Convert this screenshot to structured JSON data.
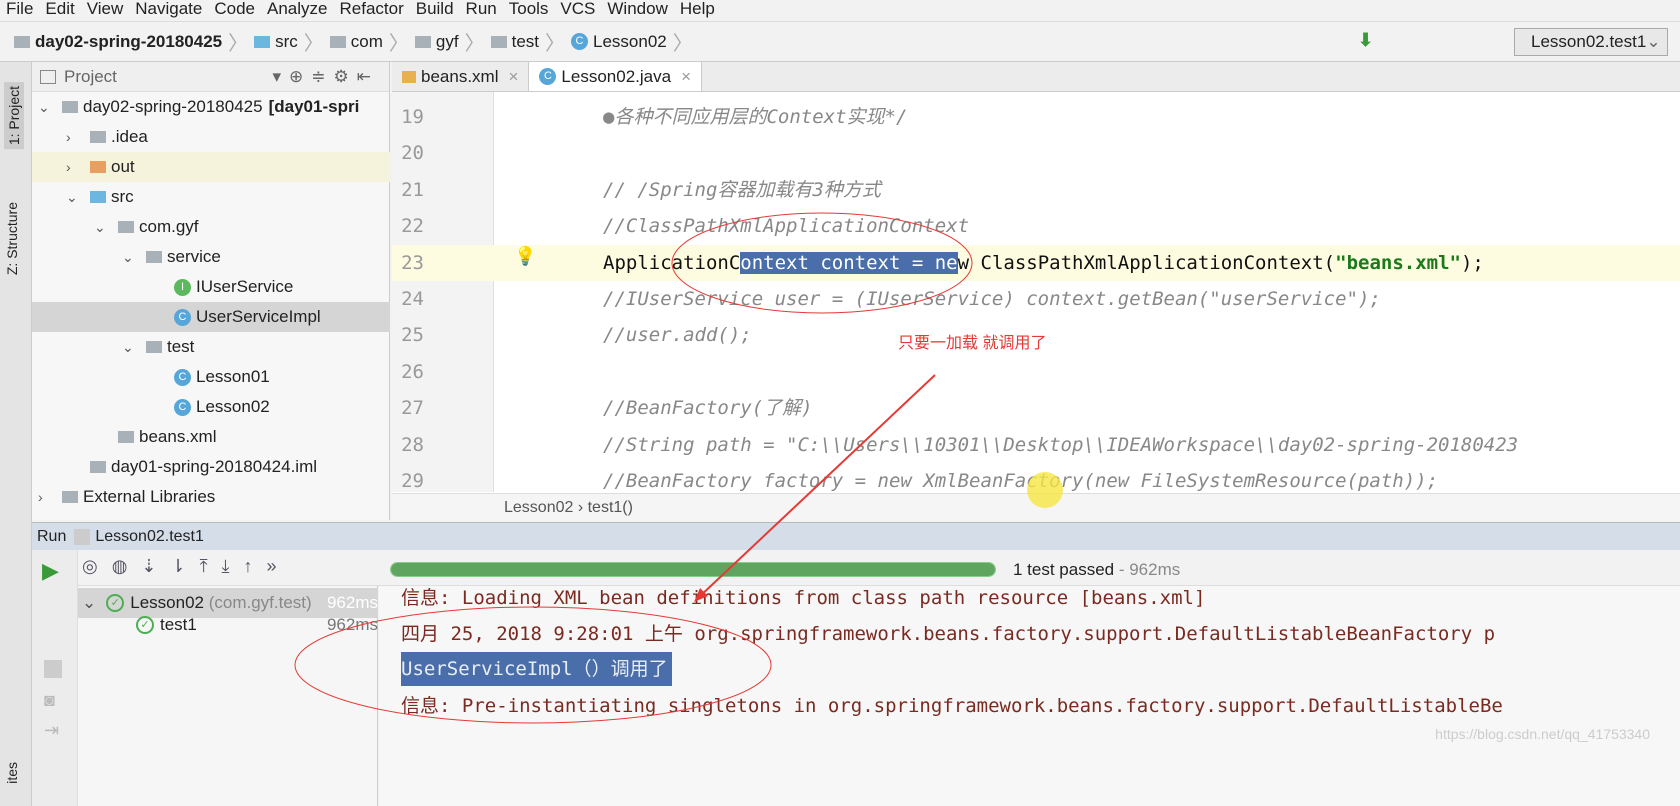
{
  "menu": [
    "File",
    "Edit",
    "View",
    "Navigate",
    "Code",
    "Analyze",
    "Refactor",
    "Build",
    "Run",
    "Tools",
    "VCS",
    "Window",
    "Help"
  ],
  "breadcrumb": [
    "day02-spring-20180425",
    "src",
    "com",
    "gyf",
    "test",
    "Lesson02"
  ],
  "run_config": "Lesson02.test1",
  "side_tabs": {
    "project": "1: Project",
    "structure": "Z: Structure",
    "favorites": "ites"
  },
  "project": {
    "title": "Project",
    "tree": [
      {
        "label": "day02-spring-20180425",
        "extra": "[day01-spri",
        "depth": 0,
        "icon": "module-icon",
        "open": true
      },
      {
        "label": ".idea",
        "depth": 1,
        "icon": "folder-icon",
        "open": false
      },
      {
        "label": "out",
        "depth": 1,
        "icon": "folder-orange-icon",
        "open": false,
        "hl": true
      },
      {
        "label": "src",
        "depth": 1,
        "icon": "folder-blue-icon",
        "open": true
      },
      {
        "label": "com.gyf",
        "depth": 2,
        "icon": "package-icon",
        "open": true
      },
      {
        "label": "service",
        "depth": 3,
        "icon": "package-icon",
        "open": true
      },
      {
        "label": "IUserService",
        "depth": 4,
        "icon": "interface-icon"
      },
      {
        "label": "UserServiceImpl",
        "depth": 4,
        "icon": "class-icon",
        "selected": true
      },
      {
        "label": "test",
        "depth": 3,
        "icon": "package-icon",
        "open": true
      },
      {
        "label": "Lesson01",
        "depth": 4,
        "icon": "class-icon"
      },
      {
        "label": "Lesson02",
        "depth": 4,
        "icon": "class-icon"
      },
      {
        "label": "beans.xml",
        "depth": 2,
        "icon": "xml-icon"
      },
      {
        "label": "day01-spring-20180424.iml",
        "depth": 1,
        "icon": "iml-icon"
      },
      {
        "label": "External Libraries",
        "depth": 0,
        "icon": "libraries-icon",
        "open": false
      }
    ]
  },
  "editor": {
    "tabs": [
      {
        "label": "beans.xml",
        "active": false
      },
      {
        "label": "Lesson02.java",
        "active": true
      }
    ],
    "lines": [
      {
        "n": "19",
        "text": "●各种不同应用层的Context实现*/"
      },
      {
        "n": "20",
        "text": ""
      },
      {
        "n": "21",
        "text": "// /Spring容器加载有3种方式"
      },
      {
        "n": "22",
        "text": "//ClassPathXmlApplicationContext"
      },
      {
        "n": "23",
        "pre": "ApplicationC",
        "sel": "ontext context = ne",
        "post": "w ClassPathXmlApplicationContext(",
        "str": "\"beans.xml\"",
        "end": ");"
      },
      {
        "n": "24",
        "text": "//IUserService user = (IUserService) context.getBean(\"userService\");"
      },
      {
        "n": "25",
        "text": "//user.add();"
      },
      {
        "n": "26",
        "text": ""
      },
      {
        "n": "27",
        "text": "//BeanFactory(了解)"
      },
      {
        "n": "28",
        "text": "//String path = \"C:\\\\Users\\\\10301\\\\Desktop\\\\IDEAWorkspace\\\\day02-spring-20180423"
      },
      {
        "n": "29",
        "text": "//BeanFactory factory = new XmlBeanFactory(new FileSystemResource(path));"
      }
    ],
    "crumb": [
      "Lesson02",
      "test1()"
    ]
  },
  "annotation": "只要一加载 就调用了",
  "run": {
    "label": "Run",
    "config": "Lesson02.test1",
    "status": "1 test passed",
    "duration": " - 962ms",
    "progress": 100,
    "tests": [
      {
        "label": "Lesson02",
        "pkg": "(com.gyf.test)",
        "time": "962ms"
      },
      {
        "label": "test1",
        "time": "962ms"
      }
    ],
    "console": [
      "信息: Loading XML bean definitions from class path resource [beans.xml]",
      "四月 25, 2018 9:28:01 上午 org.springframework.beans.factory.support.DefaultListableBeanFactory p",
      "UserServiceImpl（）调用了",
      "信息: Pre-instantiating singletons in org.springframework.beans.factory.support.DefaultListableBe"
    ]
  },
  "watermark": "https://blog.csdn.net/qq_41753340",
  "colors": {
    "accent": "#4a6ea9",
    "annotation": "#e53935",
    "success": "#5fa55f"
  }
}
